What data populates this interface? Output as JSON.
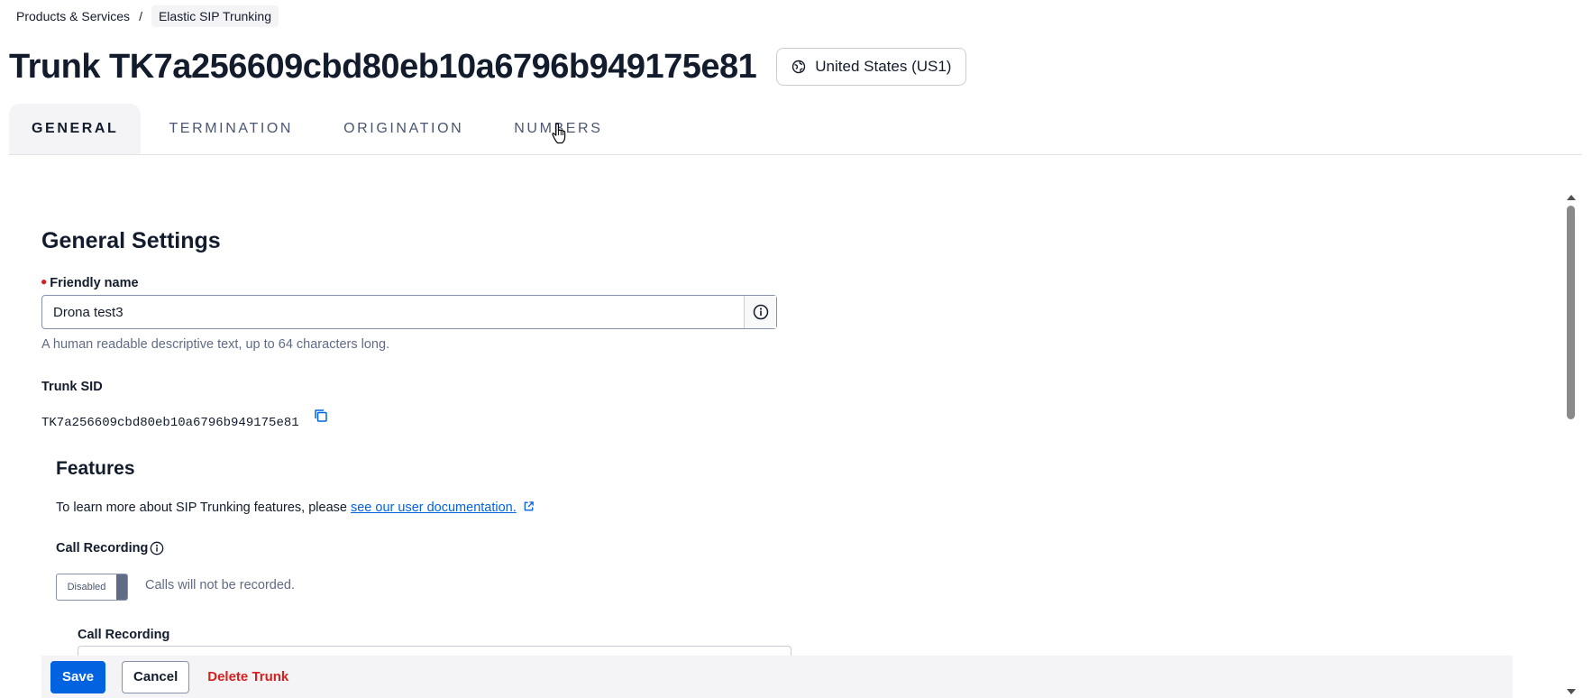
{
  "breadcrumb": {
    "parent": "Products & Services",
    "separator": "/",
    "current": "Elastic SIP Trunking"
  },
  "header": {
    "title": "Trunk TK7a256609cbd80eb10a6796b949175e81",
    "region": "United States (US1)",
    "region_icon": "globe-icon"
  },
  "tabs": [
    {
      "label": "GENERAL",
      "active": true
    },
    {
      "label": "TERMINATION",
      "active": false
    },
    {
      "label": "ORIGINATION",
      "active": false
    },
    {
      "label": "NUMBERS",
      "active": false
    }
  ],
  "general": {
    "section_title": "General Settings",
    "friendly_name": {
      "label": "Friendly name",
      "required": true,
      "value": "Drona test3",
      "help": "A human readable descriptive text, up to 64 characters long."
    },
    "trunk_sid": {
      "label": "Trunk SID",
      "value": "TK7a256609cbd80eb10a6796b949175e81"
    }
  },
  "features": {
    "title": "Features",
    "description": "To learn more about SIP Trunking features, please ",
    "link_text": "see our user documentation.",
    "call_recording": {
      "label": "Call Recording",
      "toggle_label": "Disabled",
      "toggle_state": "off",
      "status_text": "Calls will not be recorded.",
      "sub_label": "Call Recording"
    }
  },
  "footer": {
    "save": "Save",
    "cancel": "Cancel",
    "delete": "Delete Trunk"
  },
  "colors": {
    "primary": "#0263e0",
    "destructive": "#d61f1f",
    "text": "#121c2d",
    "muted": "#606b85"
  }
}
